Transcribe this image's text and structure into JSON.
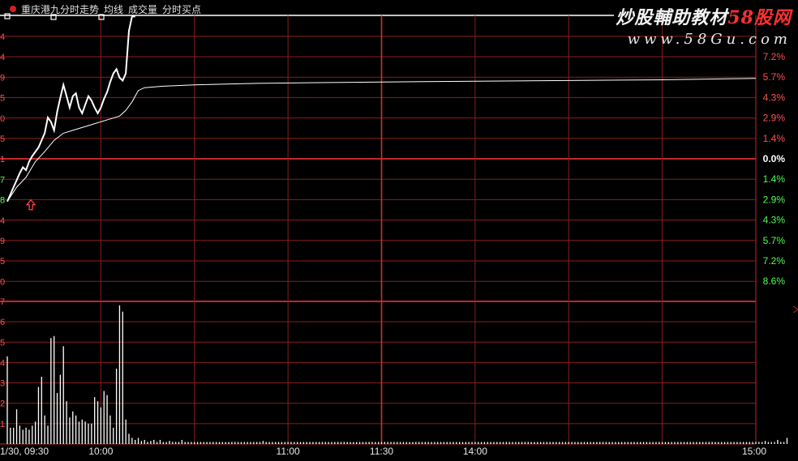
{
  "window": {
    "indicator_title": "重庆港九分时走势",
    "legend": [
      "均线",
      "成交量",
      "分时买点"
    ]
  },
  "watermark": {
    "site_name_prefix": "炒股輔助教材",
    "site_name_brand": "58股网",
    "url": "www.58Gu.com"
  },
  "axes": {
    "pct_up": [
      "7.2%",
      "5.7%",
      "4.3%",
      "2.9%",
      "1.4%"
    ],
    "pct_zero": "0.0%",
    "pct_down": [
      "1.4%",
      "2.9%",
      "4.3%",
      "5.7%",
      "7.2%",
      "8.6%"
    ],
    "left_price_stubs": [
      "4",
      "4",
      "9",
      "5",
      "0",
      "5",
      "1",
      "7",
      "8",
      "4",
      "9",
      "5",
      "0"
    ],
    "left_volume_stubs": [
      "7",
      "6",
      "5",
      "4",
      "3",
      "2",
      "1"
    ],
    "time_labels": [
      {
        "label": "1/30, 09:30",
        "minute": 0
      },
      {
        "label": "10:00",
        "minute": 30
      },
      {
        "label": "11:00",
        "minute": 90
      },
      {
        "label": "11:30",
        "minute": 120
      },
      {
        "label": "14:00",
        "minute": 150
      },
      {
        "label": "15:00",
        "minute": 240
      }
    ]
  },
  "colors": {
    "grid": "#8a1e1e",
    "grid_bright": "#c02828",
    "up_text": "#ff5050",
    "down_text": "#50ff50",
    "zero_text": "#ffffff",
    "price_line": "#ffffff",
    "avg_line": "#ffffff",
    "volume": "#ffffff"
  },
  "chart_data": [
    {
      "type": "line",
      "title": "重庆港九分时走势",
      "x_unit": "minutes since 09:30",
      "ylim_pct": [
        -8.6,
        10
      ],
      "series": [
        {
          "name": "分时走势",
          "points": [
            [
              0,
              -3.0
            ],
            [
              2,
              -2.0
            ],
            [
              4,
              -1.0
            ],
            [
              5,
              -0.6
            ],
            [
              6,
              -0.8
            ],
            [
              7,
              -0.2
            ],
            [
              8,
              0.2
            ],
            [
              10,
              0.8
            ],
            [
              12,
              1.8
            ],
            [
              13,
              2.9
            ],
            [
              14,
              2.6
            ],
            [
              15,
              2.0
            ],
            [
              16,
              3.3
            ],
            [
              17,
              4.3
            ],
            [
              18,
              5.2
            ],
            [
              19,
              4.4
            ],
            [
              20,
              3.6
            ],
            [
              21,
              4.4
            ],
            [
              22,
              4.6
            ],
            [
              23,
              3.6
            ],
            [
              24,
              3.2
            ],
            [
              25,
              3.8
            ],
            [
              26,
              4.4
            ],
            [
              27,
              4.1
            ],
            [
              28,
              3.6
            ],
            [
              29,
              3.2
            ],
            [
              30,
              3.6
            ],
            [
              31,
              4.2
            ],
            [
              32,
              4.7
            ],
            [
              33,
              5.4
            ],
            [
              34,
              6.0
            ],
            [
              35,
              6.3
            ],
            [
              36,
              5.7
            ],
            [
              37,
              5.5
            ],
            [
              38,
              6.0
            ],
            [
              39,
              9.0
            ],
            [
              40,
              10.0
            ],
            [
              41,
              10.0
            ]
          ]
        },
        {
          "name": "均线",
          "points": [
            [
              0,
              -3.0
            ],
            [
              3,
              -2.0
            ],
            [
              6,
              -1.3
            ],
            [
              9,
              -0.2
            ],
            [
              12,
              0.5
            ],
            [
              15,
              1.3
            ],
            [
              18,
              1.8
            ],
            [
              21,
              2.0
            ],
            [
              24,
              2.2
            ],
            [
              27,
              2.4
            ],
            [
              30,
              2.6
            ],
            [
              33,
              2.8
            ],
            [
              36,
              3.0
            ],
            [
              38,
              3.4
            ],
            [
              40,
              4.0
            ],
            [
              42,
              4.8
            ],
            [
              44,
              5.0
            ],
            [
              50,
              5.1
            ],
            [
              60,
              5.2
            ],
            [
              80,
              5.3
            ],
            [
              100,
              5.35
            ],
            [
              120,
              5.4
            ],
            [
              150,
              5.45
            ],
            [
              180,
              5.5
            ],
            [
              210,
              5.55
            ],
            [
              240,
              5.65
            ]
          ]
        }
      ],
      "markers": [
        {
          "name": "buy-point",
          "minute": 6,
          "pct": -3.0
        }
      ]
    },
    {
      "type": "bar",
      "title": "成交量",
      "x_unit": "minutes since 09:30",
      "ylim": [
        0,
        7
      ],
      "values": [
        4.3,
        0.8,
        0.8,
        1.7,
        0.9,
        0.7,
        0.8,
        0.7,
        0.9,
        1.1,
        2.8,
        3.3,
        1.4,
        0.9,
        5.2,
        5.3,
        2.5,
        3.4,
        4.8,
        2.1,
        1.3,
        1.6,
        1.4,
        1.1,
        1.2,
        1.1,
        1.0,
        1.0,
        2.3,
        2.1,
        1.8,
        2.6,
        2.4,
        1.4,
        0.8,
        3.7,
        6.8,
        6.5,
        1.2,
        0.5,
        0.3,
        0.2,
        0.3,
        0.15,
        0.2,
        0.1,
        0.15,
        0.2,
        0.1,
        0.2,
        0.1,
        0.1,
        0.15,
        0.1,
        0.1,
        0.1,
        0.2,
        0.1,
        0.1,
        0.1,
        0.1,
        0.1,
        0.1,
        0.1,
        0.1,
        0.1,
        0.1,
        0.1,
        0.1,
        0.1,
        0.1,
        0.1,
        0.1,
        0.1,
        0.1,
        0.1,
        0.1,
        0.1,
        0.1,
        0.1,
        0.1,
        0.1,
        0.15,
        0.1,
        0.1,
        0.1,
        0.1,
        0.1,
        0.1,
        0.1,
        0.1,
        0.1,
        0.1,
        0.1,
        0.1,
        0.1,
        0.1,
        0.1,
        0.1,
        0.1,
        0.1,
        0.1,
        0.1,
        0.1,
        0.1,
        0.1,
        0.1,
        0.1,
        0.1,
        0.1,
        0.1,
        0.1,
        0.1,
        0.1,
        0.1,
        0.1,
        0.1,
        0.1,
        0.1,
        0.1,
        0.1,
        0.1,
        0.1,
        0.1,
        0.1,
        0.1,
        0.1,
        0.1,
        0.1,
        0.1,
        0.1,
        0.1,
        0.1,
        0.1,
        0.1,
        0.1,
        0.1,
        0.1,
        0.1,
        0.1,
        0.1,
        0.1,
        0.1,
        0.1,
        0.1,
        0.1,
        0.1,
        0.1,
        0.1,
        0.1,
        0.1,
        0.1,
        0.1,
        0.1,
        0.1,
        0.1,
        0.1,
        0.1,
        0.1,
        0.1,
        0.1,
        0.1,
        0.1,
        0.1,
        0.1,
        0.1,
        0.1,
        0.1,
        0.1,
        0.1,
        0.1,
        0.1,
        0.1,
        0.1,
        0.1,
        0.1,
        0.1,
        0.1,
        0.1,
        0.1,
        0.1,
        0.1,
        0.1,
        0.1,
        0.1,
        0.1,
        0.1,
        0.1,
        0.1,
        0.1,
        0.1,
        0.1,
        0.1,
        0.1,
        0.1,
        0.1,
        0.1,
        0.1,
        0.1,
        0.1,
        0.1,
        0.1,
        0.1,
        0.1,
        0.1,
        0.1,
        0.1,
        0.1,
        0.1,
        0.1,
        0.1,
        0.1,
        0.1,
        0.1,
        0.1,
        0.1,
        0.1,
        0.1,
        0.1,
        0.1,
        0.1,
        0.1,
        0.1,
        0.1,
        0.1,
        0.1,
        0.1,
        0.1,
        0.1,
        0.1,
        0.1,
        0.1,
        0.1,
        0.1,
        0.1,
        0.1,
        0.1,
        0.1,
        0.1,
        0.1,
        0.1,
        0.1,
        0.1,
        0.15,
        0.1,
        0.1,
        0.1,
        0.2,
        0.1,
        0.1,
        0.3
      ]
    }
  ]
}
